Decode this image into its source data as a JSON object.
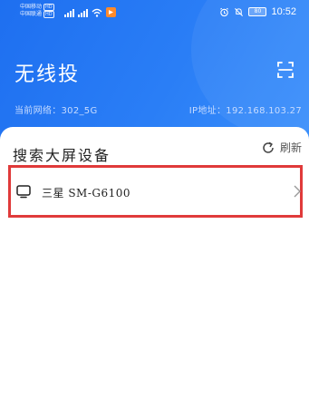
{
  "status_bar": {
    "carrier_1": "中国移动",
    "carrier_2": "中国联通",
    "hd_1": "HD",
    "hd_2": "HD",
    "signal_1_label": "4G",
    "signal_2_label": "4G",
    "battery": "80",
    "time": "10:52",
    "icons": [
      "alarm-icon",
      "mute-icon",
      "battery-icon",
      "wifi-icon",
      "app-notification-icon"
    ]
  },
  "header": {
    "title": "无线投",
    "network_label": "当前网络：302_5G",
    "ip_label": "IP地址：192.168.103.27",
    "scan_icon": "scan-icon"
  },
  "panel": {
    "title": "搜索大屏设备",
    "refresh_label": "刷新"
  },
  "devices": [
    {
      "name": "三星 SM-G6100",
      "icon": "tv-icon"
    }
  ],
  "colors": {
    "header_blue": "#2a7ef6",
    "highlight_red": "#e03a3a"
  }
}
